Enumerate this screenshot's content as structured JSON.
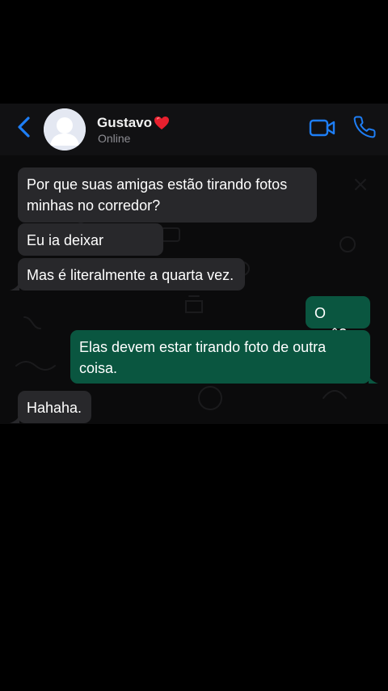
{
  "header": {
    "contact_name": "Gustavo",
    "contact_emoji": "heart-emoji",
    "status": "Online",
    "accent_color": "#1e7ef5"
  },
  "icons": {
    "back": "chevron-left-icon",
    "video": "video-camera-icon",
    "phone": "phone-icon",
    "avatar": "default-person-avatar"
  },
  "messages": [
    {
      "direction": "incoming",
      "text": "Por que suas amigas estão tirando fotos minhas no corredor?"
    },
    {
      "direction": "incoming",
      "text": "Eu ia deixar passar."
    },
    {
      "direction": "incoming",
      "text": "Mas é literalmente a quarta vez."
    },
    {
      "direction": "outgoing",
      "text": "O quê?"
    },
    {
      "direction": "outgoing",
      "text": "Elas devem estar tirando foto de outra coisa."
    },
    {
      "direction": "incoming",
      "text": "Hahaha."
    }
  ],
  "colors": {
    "background": "#000000",
    "header_bg": "#111113",
    "incoming_bubble": "#28282b",
    "outgoing_bubble": "#0a5640",
    "text": "#ffffff",
    "status_text": "#8d8d93"
  }
}
